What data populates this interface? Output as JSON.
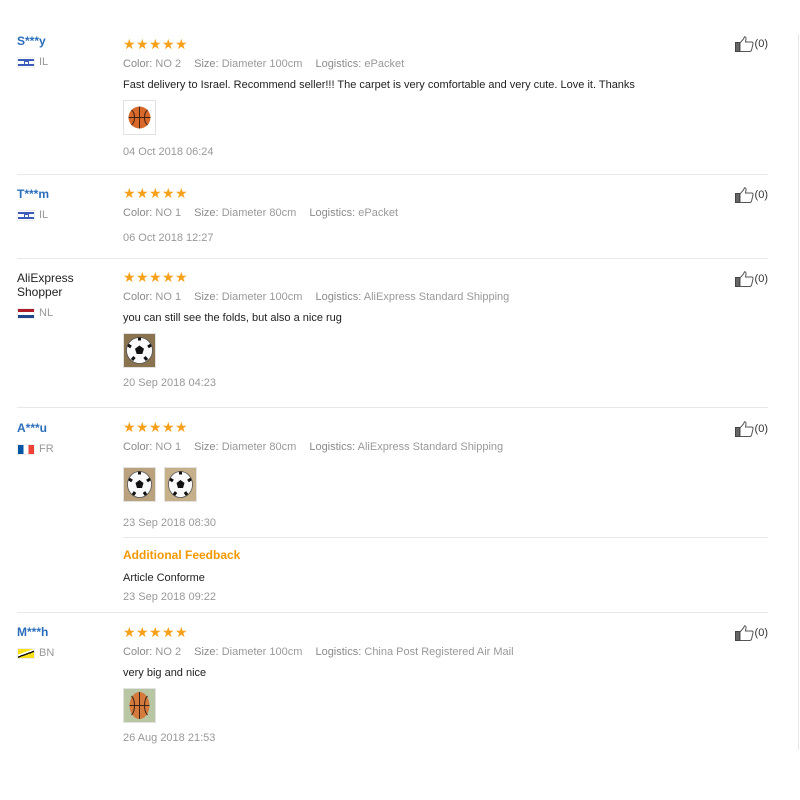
{
  "reviews": [
    {
      "user": "S***y",
      "country": "IL",
      "rating": 5,
      "color_label": "Color:",
      "color": "NO 2",
      "size_label": "Size:",
      "size": "Diameter 100cm",
      "logistics_label": "Logistics:",
      "logistics": "ePacket",
      "text": "Fast delivery to Israel. Recommend seller!!! The carpet is very comfortable and very cute. Love it. Thanks",
      "photos": [
        "basketball-rug-photo"
      ],
      "date": "04 Oct 2018 06:24",
      "helpful": "(0)"
    },
    {
      "user": "T***m",
      "country": "IL",
      "rating": 5,
      "color_label": "Color:",
      "color": "NO 1",
      "size_label": "Size:",
      "size": "Diameter 80cm",
      "logistics_label": "Logistics:",
      "logistics": "ePacket",
      "date": "06 Oct 2018 12:27",
      "helpful": "(0)"
    },
    {
      "user": "AliExpress Shopper",
      "country": "NL",
      "rating": 5,
      "color_label": "Color:",
      "color": "NO 1",
      "size_label": "Size:",
      "size": "Diameter 100cm",
      "logistics_label": "Logistics:",
      "logistics": "AliExpress Standard Shipping",
      "text": "you can still see the folds, but also a nice rug",
      "photos": [
        "soccer-rug-photo"
      ],
      "date": "20 Sep 2018 04:23",
      "helpful": "(0)"
    },
    {
      "user": "A***u",
      "country": "FR",
      "rating": 5,
      "color_label": "Color:",
      "color": "NO 1",
      "size_label": "Size:",
      "size": "Diameter 80cm",
      "logistics_label": "Logistics:",
      "logistics": "AliExpress Standard Shipping",
      "photos": [
        "soccer-rug-photo",
        "soccer-rug-photo"
      ],
      "date": "23 Sep 2018 08:30",
      "additional_title": "Additional Feedback",
      "additional_text": "Article Conforme",
      "additional_date": "23 Sep 2018 09:22",
      "helpful": "(0)"
    },
    {
      "user": "M***h",
      "country": "BN",
      "rating": 5,
      "color_label": "Color:",
      "color": "NO 2",
      "size_label": "Size:",
      "size": "Diameter 100cm",
      "logistics_label": "Logistics:",
      "logistics": "China Post Registered Air Mail",
      "text": "very big and nice",
      "photos": [
        "basketball-rug-photo"
      ],
      "date": "26 Aug 2018 21:53",
      "helpful": "(0)"
    }
  ],
  "colors": {
    "star": "#f7a01a",
    "username": "#2a6ebb",
    "additional_feedback": "#f39800",
    "muted": "#999999"
  },
  "icons": {
    "star": "star-icon",
    "helpful": "thumbs-up-icon"
  }
}
